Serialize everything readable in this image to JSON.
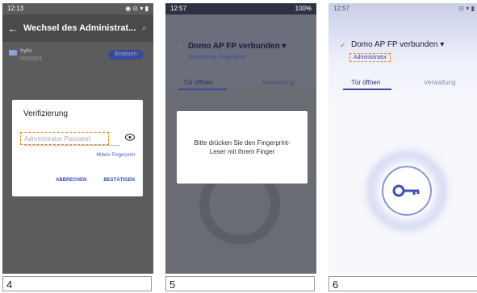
{
  "panel4": {
    "statusbar": {
      "time": "12:13",
      "icons": "◉ ⊙ ▾ ▮"
    },
    "appbar": {
      "back_glyph": "←",
      "title": "Wechsel des Administrat...",
      "search_glyph": "⌕"
    },
    "list_item": {
      "name": "Iryks",
      "id": "0000001",
      "action_label": "Ersetzen"
    },
    "dialog": {
      "title": "Verifizierung",
      "password_placeholder": "Administrator Passwort",
      "fingerprint_link": "Mittels Fingerprint",
      "cancel_label": "ABBRECHEN",
      "confirm_label": "BESTÄTIGEN"
    },
    "caption": "4"
  },
  "panel5": {
    "statusbar": {
      "time": "12:57",
      "right": "100%"
    },
    "device_title": "Domo AP FP verbunden ▾",
    "sub": "Anmeldung Fingerprint",
    "tab_open": "Tür öffnen",
    "tab_manage": "Verwaltung",
    "message": "Bitte drücken Sie den Fingerprint-Leser mit Ihrem Finger",
    "caption": "5"
  },
  "panel6": {
    "statusbar": {
      "time": "12:57",
      "icons": "⊙ ▾ ▮"
    },
    "check_glyph": "✓",
    "device_title": "Domo AP FP verbunden ▾",
    "role": "Administrator",
    "tab_open": "Tür öffnen",
    "tab_manage": "Verwaltung",
    "caption": "6"
  },
  "colors": {
    "accent": "#3a48a0",
    "highlight_dash": "#f08a24",
    "key_blue": "#3e4fb8"
  }
}
